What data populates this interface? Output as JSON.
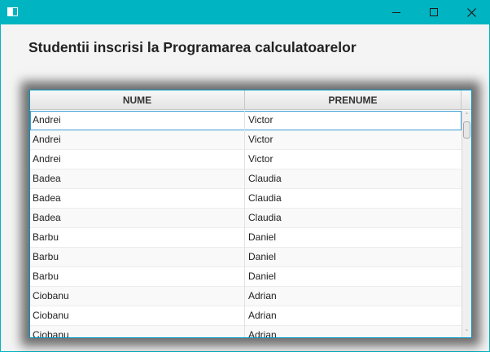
{
  "window": {
    "title": "",
    "icon": "window-icon",
    "controls": [
      "minimize-icon",
      "maximize-icon",
      "close-icon"
    ],
    "close_glyph": "✕"
  },
  "heading": "Studentii inscrisi la Programarea calculatoarelor",
  "table": {
    "columns": [
      "NUME",
      "PRENUME"
    ],
    "rows": [
      [
        "Andrei",
        "Victor"
      ],
      [
        "Andrei",
        "Victor"
      ],
      [
        "Andrei",
        "Victor"
      ],
      [
        "Badea",
        "Claudia"
      ],
      [
        "Badea",
        "Claudia"
      ],
      [
        "Badea",
        "Claudia"
      ],
      [
        "Barbu",
        "Daniel"
      ],
      [
        "Barbu",
        "Daniel"
      ],
      [
        "Barbu",
        "Daniel"
      ],
      [
        "Ciobanu",
        "Adrian"
      ],
      [
        "Ciobanu",
        "Adrian"
      ],
      [
        "Ciobanu",
        "Adrian"
      ]
    ],
    "selected_row": 0,
    "scrollbar": {
      "up_icon": "˄",
      "down_icon": "˅"
    }
  },
  "colors": {
    "titlebar": "#00b4c2",
    "focus_border": "#0096c9"
  }
}
